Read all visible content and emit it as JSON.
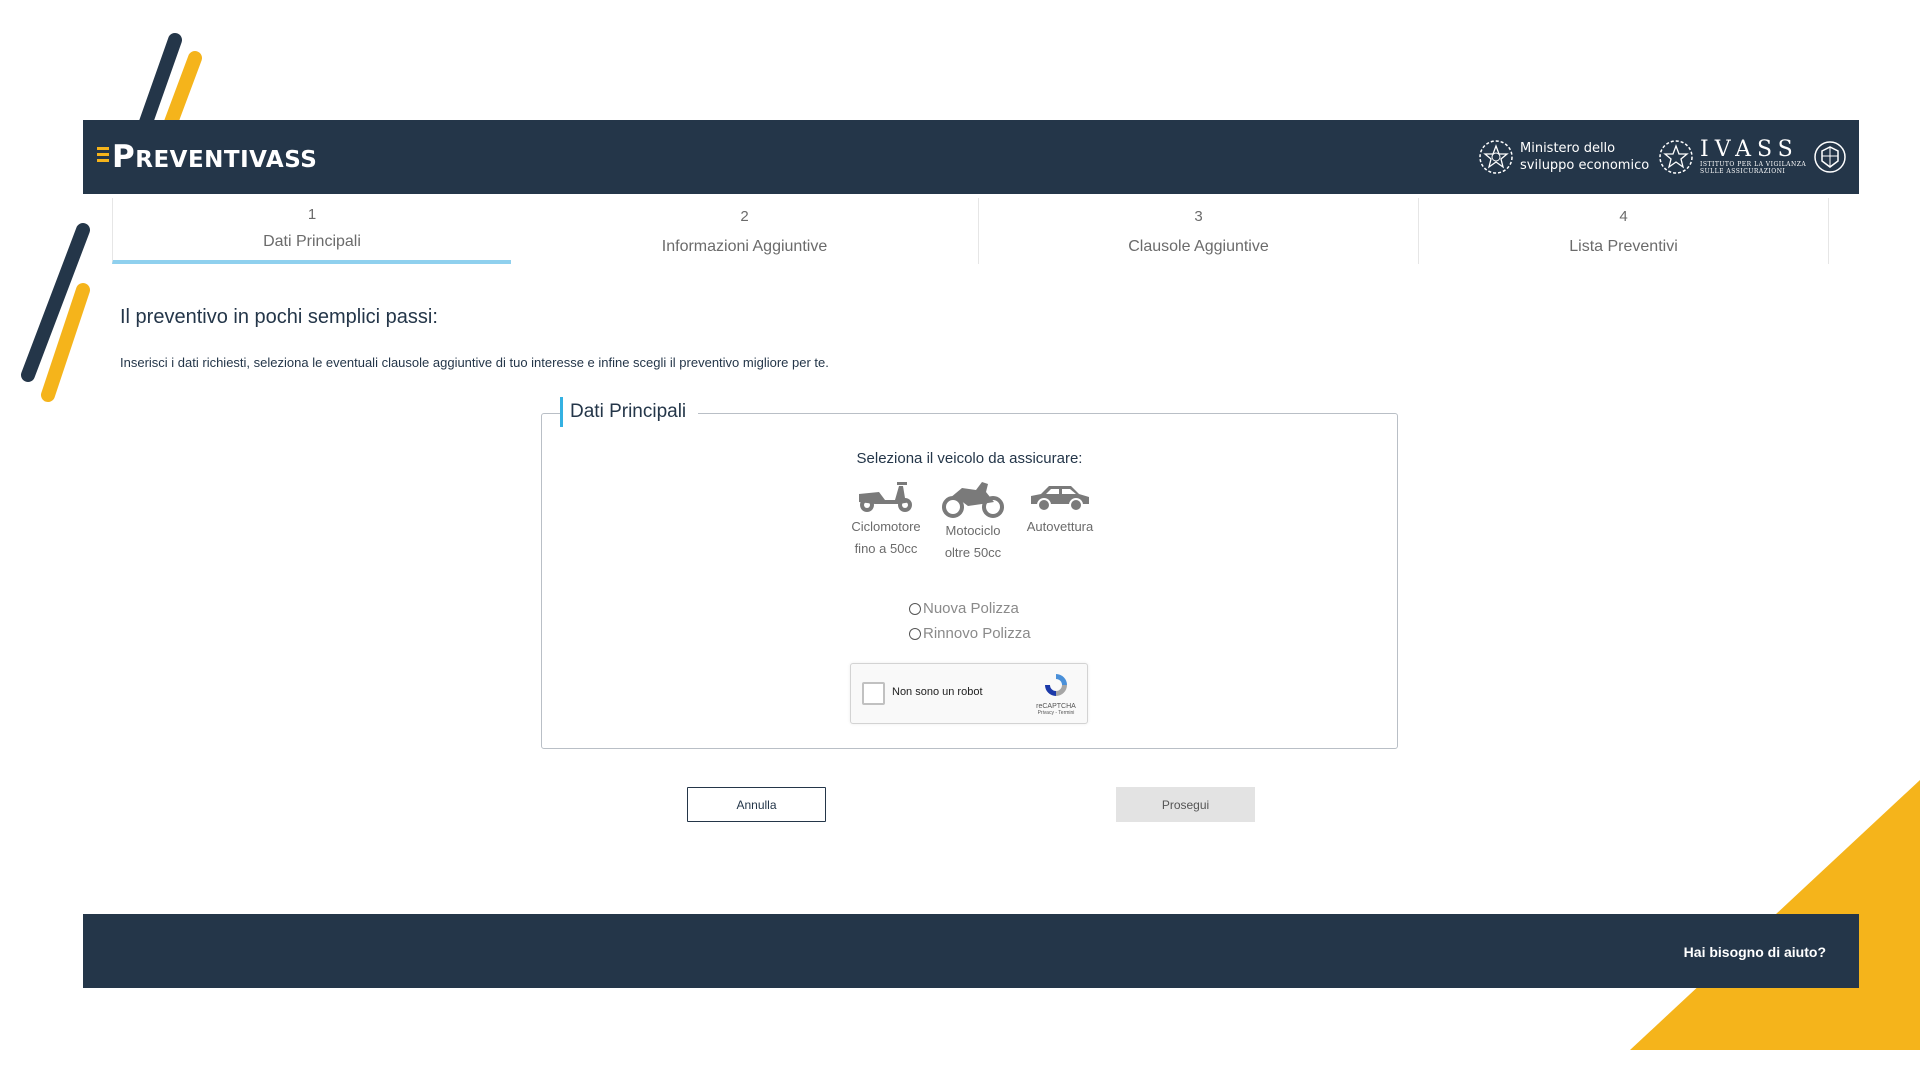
{
  "colors": {
    "navy": "#243649",
    "accent_yellow": "#f5b41b",
    "accent_blue": "#34b1e2",
    "step_underline": "#8fd0ee",
    "disabled_button": "#e3e3e3"
  },
  "header": {
    "logo": {
      "first_letter": "P",
      "rest": "REVENTIVASS",
      "icon": "menu-bars-icon"
    },
    "ministero": {
      "line1": "Ministero dello",
      "line2": "sviluppo economico",
      "icon": "italian-emblem-icon"
    },
    "ivass": {
      "name": "IVASS",
      "sub1": "ISTITUTO PER LA VIGILANZA",
      "sub2": "SULLE ASSICURAZIONI",
      "icons": [
        "italian-emblem-icon",
        "ivass-crest-icon"
      ]
    }
  },
  "steps": [
    {
      "number": "1",
      "label": "Dati Principali",
      "active": true
    },
    {
      "number": "2",
      "label": "Informazioni Aggiuntive",
      "active": false
    },
    {
      "number": "3",
      "label": "Clausole Aggiuntive",
      "active": false
    },
    {
      "number": "4",
      "label": "Lista Preventivi",
      "active": false
    }
  ],
  "intro": {
    "headline": "Il preventivo in pochi semplici passi:",
    "text": "Inserisci i dati richiesti, seleziona le eventuali clausole aggiuntive di tuo interesse e infine scegli il preventivo migliore per te."
  },
  "form": {
    "legend": "Dati Principali",
    "vehicle_prompt": "Seleziona il veicolo da assicurare:",
    "vehicles": [
      {
        "line1": "Ciclomotore",
        "line2": "fino a 50cc",
        "icon": "scooter-icon"
      },
      {
        "line1": "Motociclo",
        "line2": "oltre 50cc",
        "icon": "motorcycle-icon"
      },
      {
        "line1": "Autovettura",
        "line2": "",
        "icon": "car-icon"
      }
    ],
    "policy_options": [
      {
        "label": "Nuova Polizza",
        "checked": false
      },
      {
        "label": "Rinnovo Polizza",
        "checked": false
      }
    ],
    "recaptcha": {
      "label": "Non sono un robot",
      "brand": "reCAPTCHA",
      "terms": "Privacy - Termini",
      "icon": "recaptcha-icon"
    }
  },
  "buttons": {
    "cancel": "Annulla",
    "next": "Prosegui"
  },
  "footer": {
    "help": "Hai bisogno di aiuto?"
  }
}
